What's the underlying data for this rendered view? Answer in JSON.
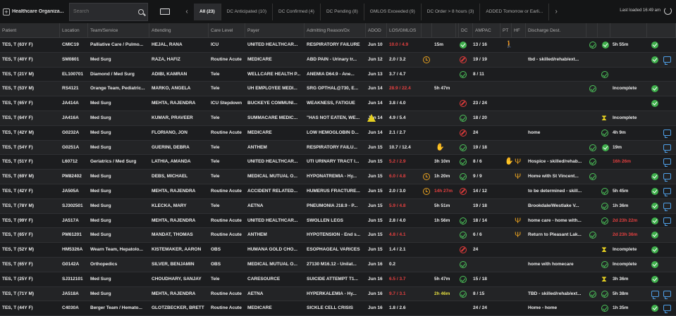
{
  "topbar": {
    "org_label": "Healthcare Organiza...",
    "search_placeholder": "Search",
    "tabs": [
      "All (23)",
      "DC Anticipated (10)",
      "DC Confirmed (4)",
      "DC Pending (8)",
      "GMLOS Exceeded (9)",
      "DC Order > 8 hours (3)",
      "ADDED Tomorrow or Earli..."
    ],
    "last_updated": "Last loaded 16:49 am"
  },
  "columns": [
    "Patient",
    "Location",
    "Team/Service",
    "Attending",
    "Care Level",
    "Payer",
    "Admitting Reason/Dx",
    "ADOD",
    "LOS/GMLOS",
    "",
    "",
    "",
    "DC",
    "AMPAC",
    "PT",
    "HF",
    "Discharge Dest.",
    "",
    "",
    "",
    ""
  ],
  "rows": [
    {
      "patient": "TES, T (63Y F)",
      "loc": "CMIC19",
      "team": "Palliative Care / Pulmo...",
      "att": "HEJAL, RANA",
      "lvl": "ICU",
      "payer": "UNITED HEALTHCAR...",
      "dx": "RESPIRATORY FAILURE",
      "adod": "Jun 10",
      "los": "10.0 / 4.9",
      "los_c": "red",
      "time": "15m",
      "ampac": "13 / 16",
      "dest": "",
      "dur": "5h 55m"
    },
    {
      "patient": "TES, T (40Y F)",
      "loc": "SM0801",
      "team": "Med Surg",
      "att": "RAZA, HAFIZ",
      "lvl": "Routine Acute",
      "payer": "MEDICARE",
      "dx": "ABD PAIN - Urinary tr...",
      "adod": "Jun 12",
      "los": "2.0 / 3.2",
      "los_c": "",
      "time": "",
      "ampac": "19 / 19",
      "dest": "tbd - skilled/rehab/ext...",
      "dur": ""
    },
    {
      "patient": "TES, T (21Y M)",
      "loc": "EL100701",
      "team": "Diamond / Med Surg",
      "att": "ADIBI, KAMRAN",
      "lvl": "Tele",
      "payer": "WELLCARE HEALTH P...",
      "dx": "ANEMIA D64.9 - Ane...",
      "adod": "Jun 13",
      "los": "3.7 / 4.7",
      "los_c": "",
      "time": "",
      "ampac": "8 / 11",
      "dest": "",
      "dur": ""
    },
    {
      "patient": "TES, T (53Y M)",
      "loc": "RS4121",
      "team": "Orange Team, Pediatric...",
      "att": "MARKO, ANGELA",
      "lvl": "Tele",
      "payer": "UH EMPLOYEE MEDI...",
      "dx": "SRG OPTHAL@730, E...",
      "adod": "Jun 14",
      "los": "28.9 / 22.4",
      "los_c": "red",
      "time": "5h 47m",
      "ampac": "",
      "dest": "",
      "dur": "Incomplete"
    },
    {
      "patient": "TES, T (65Y F)",
      "loc": "JA414A",
      "team": "Med Surg",
      "att": "MEHTA, RAJENDRA",
      "lvl": "ICU Stepdown",
      "payer": "BUCKEYE COMMUNI...",
      "dx": "WEAKNESS, FATIGUE",
      "adod": "Jun 14",
      "los": "3.8 / 4.0",
      "los_c": "",
      "time": "",
      "ampac": "23 / 24",
      "dest": "",
      "dur": ""
    },
    {
      "patient": "TES, T (64Y F)",
      "loc": "JA416A",
      "team": "Med Surg",
      "att": "KUMAR, PRAVEER",
      "lvl": "Tele",
      "payer": "SUMMACARE MEDIC...",
      "dx": "\"HAS NOT EATEN, WE...",
      "adod": "Jun 14",
      "los": "4.9 / 5.4",
      "los_c": "",
      "time": "",
      "ampac": "18 / 20",
      "dest": "",
      "dur": "Incomplete"
    },
    {
      "patient": "TES, T (42Y M)",
      "loc": "G0232A",
      "team": "Med Surg",
      "att": "FLORIANO, JON",
      "lvl": "Routine Acute",
      "payer": "MEDICARE",
      "dx": "LOW HEMOGLOBIN D...",
      "adod": "Jun 14",
      "los": "2.1 / 2.7",
      "los_c": "",
      "time": "",
      "ampac": "24",
      "dest": "home",
      "dur": "4h 9m"
    },
    {
      "patient": "TES, T (54Y F)",
      "loc": "G0251A",
      "team": "Med Surg",
      "att": "GUERINI, DEBRA",
      "lvl": "Tele",
      "payer": "ANTHEM",
      "dx": "RESPIRATORY FAILU...",
      "adod": "Jun 15",
      "los": "10.7 / 12.4",
      "los_c": "",
      "time": "",
      "ampac": "19 / 18",
      "dest": "",
      "dur": "19m"
    },
    {
      "patient": "TES, T (51Y F)",
      "loc": "L60712",
      "team": "Geriatrics / Med Surg",
      "att": "LATHIA, AMANDA",
      "lvl": "Tele",
      "payer": "UNITED HEALTHCAR...",
      "dx": "UTI URINARY TRACT I...",
      "adod": "Jun 15",
      "los": "5.2 / 2.9",
      "los_c": "red",
      "time": "3h 10m",
      "ampac": "8 / 6",
      "dest": "Hospice - skilled/rehab...",
      "dur": "16h 26m"
    },
    {
      "patient": "TES, T (69Y M)",
      "loc": "PM82402",
      "team": "Med Surg",
      "att": "DEBS, MICHAEL",
      "lvl": "Tele",
      "payer": "MEDICAL MUTUAL O...",
      "dx": "HYPONATREMIA - Hy...",
      "adod": "Jun 15",
      "los": "6.0 / 4.8",
      "los_c": "red",
      "time": "1h 20m",
      "ampac": "9 / 9",
      "dest": "Home with St Vincent...",
      "dur": ""
    },
    {
      "patient": "TES, T (42Y F)",
      "loc": "JA505A",
      "team": "Med Surg",
      "att": "MEHTA, RAJENDRA",
      "lvl": "Routine Acute",
      "payer": "ACCIDENT RELATED...",
      "dx": "HUMERUS FRACTURE...",
      "adod": "Jun 15",
      "los": "2.0 / 3.0",
      "los_c": "",
      "time": "14h 27m",
      "ampac": "14 / 12",
      "dest": "to be determined - skill...",
      "dur": "5h 45m"
    },
    {
      "patient": "TES, T (78Y M)",
      "loc": "SJ302501",
      "team": "Med Surg",
      "att": "KLECKA, MARY",
      "lvl": "Tele",
      "payer": "AETNA",
      "dx": "PNEUMONIA J18.9 - P...",
      "adod": "Jun 15",
      "los": "5.9 / 4.8",
      "los_c": "red",
      "time": "5h 51m",
      "ampac": "19 / 18",
      "dest": "Brookdale/Westlake V...",
      "dur": "1h 36m"
    },
    {
      "patient": "TES, T (99Y F)",
      "loc": "JA517A",
      "team": "Med Surg",
      "att": "MEHTA, RAJENDRA",
      "lvl": "Routine Acute",
      "payer": "UNITED HEALTHCAR...",
      "dx": "SWOLLEN LEGS",
      "adod": "Jun 15",
      "los": "2.8 / 4.0",
      "los_c": "",
      "time": "1h 56m",
      "ampac": "18 / 14",
      "dest": "home care - home with...",
      "dur": "2d 23h 22m"
    },
    {
      "patient": "TES, T (65Y F)",
      "loc": "PM61201",
      "team": "Med Surg",
      "att": "MANDAT, THOMAS",
      "lvl": "Routine Acute",
      "payer": "ANTHEM",
      "dx": "HYPOTENSION - End s...",
      "adod": "Jun 15",
      "los": "4.8 / 4.1",
      "los_c": "red",
      "time": "",
      "ampac": "6 / 6",
      "dest": "Return to Pleasant Lak...",
      "dur": "2d 23h 36m"
    },
    {
      "patient": "TES, T (52Y M)",
      "loc": "HM5326A",
      "team": "Wearn Team, Hepatolo...",
      "att": "KISTEMAKER, AARON",
      "lvl": "OBS",
      "payer": "HUMANA GOLD CHO...",
      "dx": "ESOPHAGEAL VARICES",
      "adod": "Jun 15",
      "los": "1.4 / 2.1",
      "los_c": "",
      "time": "",
      "ampac": "24",
      "dest": "",
      "dur": "Incomplete"
    },
    {
      "patient": "TES, T (65Y F)",
      "loc": "G0142A",
      "team": "Orthopedics",
      "att": "SILVER, BENJAMIN",
      "lvl": "OBS",
      "payer": "MEDICAL MUTUAL O...",
      "dx": "27130 M16.12 - Unilat...",
      "adod": "Jun 16",
      "los": "0.2",
      "los_c": "",
      "time": "",
      "ampac": "",
      "dest": "home with homecare",
      "dur": "Incomplete"
    },
    {
      "patient": "TES, T (25Y F)",
      "loc": "SJ312101",
      "team": "Med Surg",
      "att": "CHOUDHARY, SANJAY",
      "lvl": "Tele",
      "payer": "CARESOURCE",
      "dx": "SUICIDE ATTEMPT T1...",
      "adod": "Jun 16",
      "los": "6.5 / 3.7",
      "los_c": "red",
      "time": "5h 47m",
      "ampac": "15 / 18",
      "dest": "",
      "dur": "3h 36m"
    },
    {
      "patient": "TES, T (71Y M)",
      "loc": "JA518A",
      "team": "Med Surg",
      "att": "MEHTA, RAJENDRA",
      "lvl": "Routine Acute",
      "payer": "AETNA",
      "dx": "HYPERKALEMIA - Hy...",
      "adod": "Jun 16",
      "los": "9.7 / 3.1",
      "los_c": "red",
      "time": "2h 46m",
      "ampac": "8 / 15",
      "dest": "TBD - skilled/rehab/ext...",
      "dur": "5h 38m"
    },
    {
      "patient": "TES, T (44Y F)",
      "loc": "C4030A",
      "team": "Berger Team / Hemato...",
      "att": "GLOTZBECKER, BRETT",
      "lvl": "Routine Acute",
      "payer": "MEDICARE",
      "dx": "SICKLE CELL CRISIS",
      "adod": "Jun 16",
      "los": "1.8 / 2.6",
      "los_c": "",
      "time": "",
      "ampac": "24 / 24",
      "dest": "Home - home",
      "dur": "1h 35m"
    }
  ]
}
